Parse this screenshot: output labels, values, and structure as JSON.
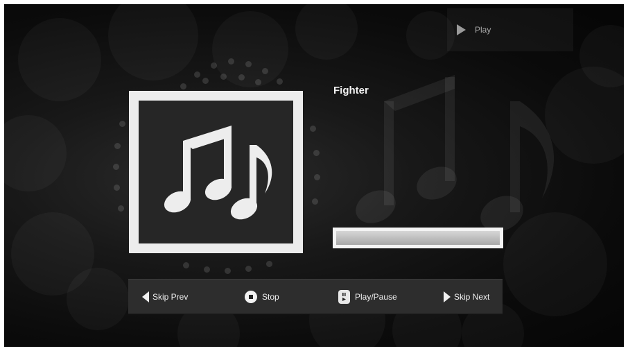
{
  "top_bar": {
    "play_label": "Play"
  },
  "now_playing": {
    "title": "Fighter",
    "progress": 0
  },
  "controls": {
    "skip_prev": "Skip Prev",
    "stop": "Stop",
    "play_pause": "Play/Pause",
    "skip_next": "Skip Next"
  },
  "icons": {
    "top_play": "play-icon",
    "album_art": "music-notes-icon",
    "skip_prev": "skip-prev-icon",
    "stop": "stop-icon",
    "play_pause": "play-pause-icon",
    "skip_next": "skip-next-icon"
  },
  "colors": {
    "background": "#0b0b0b",
    "control_bar": "#2d2d2d",
    "album_frame": "#ececec",
    "text": "#f2f2f2"
  }
}
